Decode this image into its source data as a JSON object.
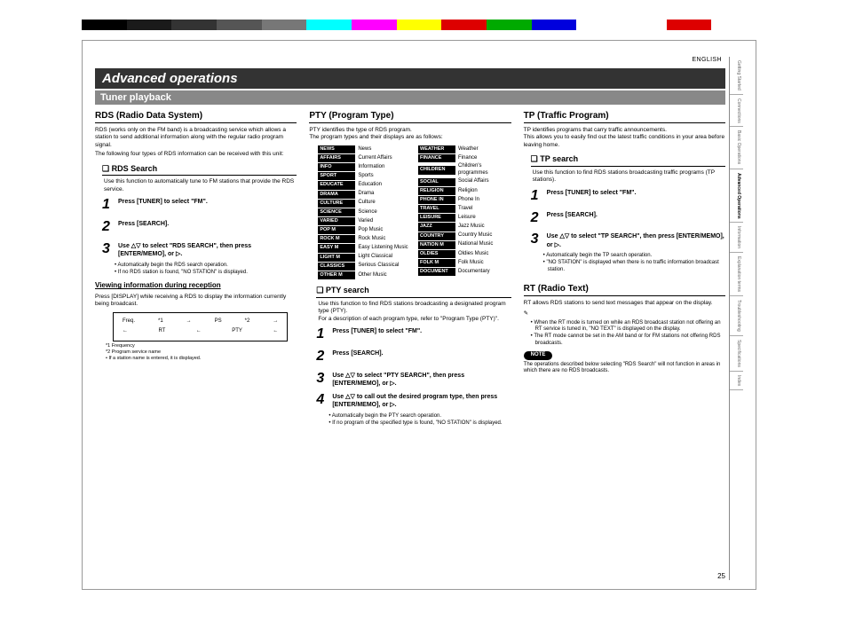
{
  "lang": "ENGLISH",
  "title": "Advanced operations",
  "subtitle": "Tuner playback",
  "pagenum": "25",
  "nav": [
    "Getting Started",
    "Connections",
    "Basic Operations",
    "Advanced Operations",
    "Information",
    "Explanation terms",
    "Troubleshooting",
    "Specifications",
    "Index"
  ],
  "nav_active": 3,
  "col1": {
    "h3": "RDS (Radio Data System)",
    "intro": "RDS (works only on the FM band) is a broadcasting service which allows a station to send additional information along with the regular radio program signal.",
    "intro2": "The following four types of RDS information can be received with this unit:",
    "h4a": "RDS Search",
    "h4a_sub": "Use this function to automatically tune to FM stations that provide the RDS service.",
    "steps": [
      "Press [TUNER] to select \"FM\".",
      "Press [SEARCH].",
      "Use △▽ to select \"RDS SEARCH\", then press [ENTER/MEMO], <ENTER> or ▷."
    ],
    "step3_subs": [
      "Automatically begin the RDS search operation.",
      "If no RDS station is found, \"NO STATION\" is displayed."
    ],
    "h4u": "Viewing information during reception",
    "viewing": "Press [DISPLAY] while receiving a RDS to display the information currently being broadcast.",
    "flow": {
      "a": "Freq.",
      "b": "PS",
      "c": "RT",
      "d": "PTY",
      "n1": "*1",
      "n2": "*2"
    },
    "legend": [
      "*1   Frequency",
      "*2   Program service name",
      "      • If a station name is entered, it is displayed."
    ]
  },
  "col2": {
    "h3": "PTY (Program Type)",
    "intro": "PTY identifies the type of RDS program.",
    "intro2": "The program types and their displays are as follows:",
    "left": [
      [
        "NEWS",
        "News"
      ],
      [
        "AFFAIRS",
        "Current Affairs"
      ],
      [
        "INFO",
        "Information"
      ],
      [
        "SPORT",
        "Sports"
      ],
      [
        "EDUCATE",
        "Education"
      ],
      [
        "DRAMA",
        "Drama"
      ],
      [
        "CULTURE",
        "Culture"
      ],
      [
        "SCIENCE",
        "Science"
      ],
      [
        "VARIED",
        "Varied"
      ],
      [
        "POP M",
        "Pop Music"
      ],
      [
        "ROCK M",
        "Rock Music"
      ],
      [
        "EASY M",
        "Easy Listening Music"
      ],
      [
        "LIGHT M",
        "Light Classical"
      ],
      [
        "CLASSICS",
        "Serious Classical"
      ],
      [
        "OTHER M",
        "Other Music"
      ]
    ],
    "right": [
      [
        "WEATHER",
        "Weather"
      ],
      [
        "FINANCE",
        "Finance"
      ],
      [
        "CHILDREN",
        "Children's programmes"
      ],
      [
        "SOCIAL",
        "Social Affairs"
      ],
      [
        "RELIGION",
        "Religion"
      ],
      [
        "PHONE IN",
        "Phone In"
      ],
      [
        "TRAVEL",
        "Travel"
      ],
      [
        "LEISURE",
        "Leisure"
      ],
      [
        "JAZZ",
        "Jazz Music"
      ],
      [
        "COUNTRY",
        "Country Music"
      ],
      [
        "NATION M",
        "National Music"
      ],
      [
        "OLDIES",
        "Oldies Music"
      ],
      [
        "FOLK M",
        "Folk Music"
      ],
      [
        "DOCUMENT",
        "Documentary"
      ]
    ],
    "h4": "PTY search",
    "h4_sub": "Use this function to find RDS stations broadcasting a designated program type (PTY).",
    "h4_sub2": "For a description of each program type, refer to \"Program Type (PTY)\".",
    "steps": [
      "Press [TUNER] to select \"FM\".",
      "Press [SEARCH].",
      "Use △▽ to select \"PTY SEARCH\", then press [ENTER/MEMO], <ENTER> or ▷.",
      "Use △▽ to call out the desired program type, then press [ENTER/MEMO], <ENTER> or ▷."
    ],
    "step4_subs": [
      "Automatically begin the PTY search operation.",
      "If no program of the specified type is found, \"NO STATION\" is displayed."
    ]
  },
  "col3": {
    "h3a": "TP (Traffic Program)",
    "tp_intro": "TP identifies programs that carry traffic announcements.",
    "tp_intro2": "This allows you to easily find out the latest traffic conditions in your area before leaving home.",
    "h4": "TP search",
    "h4_sub": "Use this function to find RDS stations broadcasting traffic programs (TP stations).",
    "steps": [
      "Press [TUNER] to select \"FM\".",
      "Press [SEARCH].",
      "Use △▽ to select \"TP SEARCH\", then press [ENTER/MEMO], <ENTER> or ▷."
    ],
    "step3_subs": [
      "Automatically begin the TP search operation.",
      "\"NO STATION\" is displayed when there is no traffic information broadcast station."
    ],
    "h3b": "RT (Radio Text)",
    "rt_intro": "RT allows RDS stations to send text messages that appear on the display.",
    "rt_bullets": [
      "When the RT mode is turned on while an RDS broadcast station not offering an RT service is tuned in, \"NO TEXT\" is displayed on the display.",
      "The RT mode cannot be set in the AM band or for FM stations not offering RDS broadcasts."
    ],
    "note_label": "NOTE",
    "note": "The operations described below selecting \"RDS Search\" will not function in areas in which there are no RDS broadcasts."
  },
  "colors": [
    "#000",
    "#1a1a1a",
    "#333",
    "#555",
    "#777",
    "#0ff",
    "#f0f",
    "#ff0",
    "#d00",
    "#0a0",
    "#00d",
    "#fff",
    "#fff",
    "#d00",
    "#fff"
  ]
}
